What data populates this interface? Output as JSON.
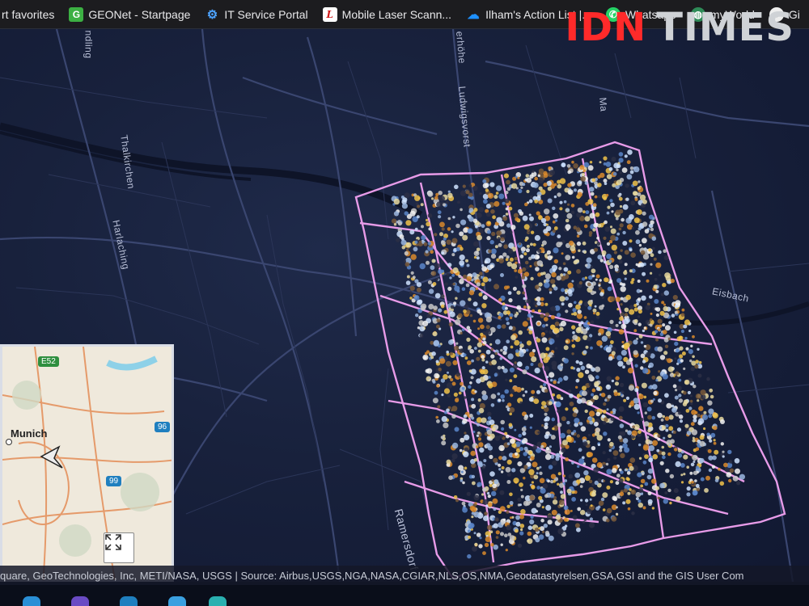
{
  "bookmarks": [
    {
      "label": "rt favorites",
      "icon": "none"
    },
    {
      "label": "GEONet - Startpage",
      "icon": "geonet-icon",
      "glyph": "G"
    },
    {
      "label": "IT Service Portal",
      "icon": "service-portal-icon",
      "glyph": "⚙"
    },
    {
      "label": "Mobile Laser Scann...",
      "icon": "laser-scan-icon",
      "glyph": "L"
    },
    {
      "label": "Ilham's Action List |...",
      "icon": "salesforce-cloud-icon",
      "glyph": "☁"
    },
    {
      "label": "Whatsapp",
      "icon": "whatsapp-icon",
      "glyph": "✆"
    },
    {
      "label": "myWorld",
      "icon": "globe-icon",
      "glyph": "◍"
    },
    {
      "label": "Gi",
      "icon": "github-icon",
      "glyph": "●"
    }
  ],
  "watermark": {
    "brand_a": "IDN",
    "brand_b": "TIMES"
  },
  "places": {
    "ndling": "ndling",
    "thalkirchen": "Thalkirchen",
    "harlaching": "Harlaching",
    "ludwigsvorst": "Ludwigsvorst",
    "erhohe": "erhöhe",
    "ma": "Ma",
    "eisbach": "Eisbach",
    "ramersdorf": "Ramersdorf"
  },
  "overview": {
    "city": "Munich",
    "badges": [
      "E52",
      "96",
      "99"
    ]
  },
  "attribution": "quare, GeoTechnologies, Inc, METI/NASA, USGS | Source: Airbus,USGS,NGA,NASA,CGIAR,NLS,OS,NMA,Geodatastyrelsen,GSA,GSI and the GIS User Com",
  "colors": {
    "survey_outline": "#e79be8",
    "map_bg": "#18213c",
    "road": "#3a4670",
    "accent_watermark": "#ff2a2a"
  }
}
